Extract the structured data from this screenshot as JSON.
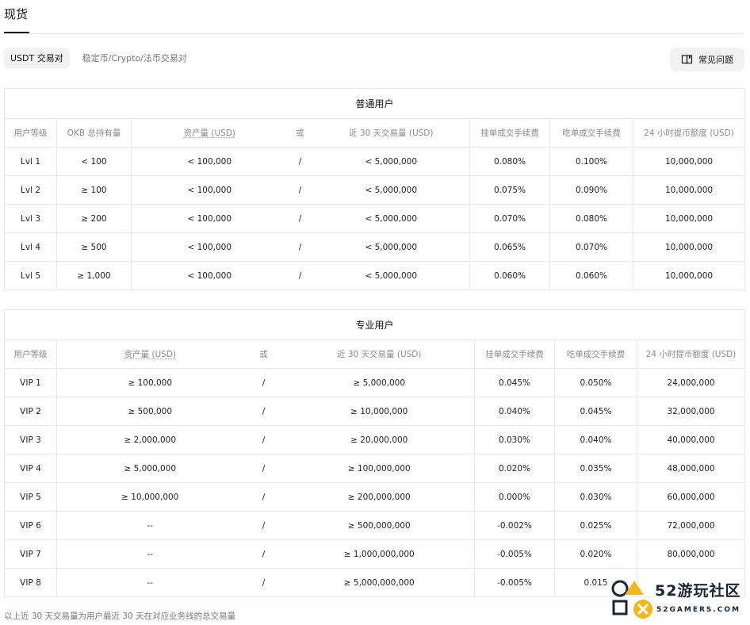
{
  "top_tab": "现货",
  "filters": {
    "active": "USDT 交易对",
    "other": "稳定币/Crypto/法币交易对"
  },
  "faq": "常见问题",
  "regular": {
    "title": "普通用户",
    "headers": [
      "用户等级",
      "OKB 总持有量",
      "资产量 (USD)",
      "或",
      "近 30 天交易量 (USD)",
      "挂单成交手续费",
      "吃单成交手续费",
      "24 小时提币额度 (USD)"
    ],
    "rows": [
      [
        "Lvl 1",
        "< 100",
        "< 100,000",
        "/",
        "< 5,000,000",
        "0.080%",
        "0.100%",
        "10,000,000"
      ],
      [
        "Lvl 2",
        "≥ 100",
        "< 100,000",
        "/",
        "< 5,000,000",
        "0.075%",
        "0.090%",
        "10,000,000"
      ],
      [
        "Lvl 3",
        "≥ 200",
        "< 100,000",
        "/",
        "< 5,000,000",
        "0.070%",
        "0.080%",
        "10,000,000"
      ],
      [
        "Lvl 4",
        "≥ 500",
        "< 100,000",
        "/",
        "< 5,000,000",
        "0.065%",
        "0.070%",
        "10,000,000"
      ],
      [
        "Lvl 5",
        "≥ 1,000",
        "< 100,000",
        "/",
        "< 5,000,000",
        "0.060%",
        "0.060%",
        "10,000,000"
      ]
    ]
  },
  "pro": {
    "title": "专业用户",
    "headers": [
      "用户等级",
      "资产量 (USD)",
      "或",
      "近 30 天交易量 (USD)",
      "挂单成交手续费",
      "吃单成交手续费",
      "24 小时提币额度 (USD)"
    ],
    "rows": [
      [
        "VIP 1",
        "≥ 100,000",
        "/",
        "≥ 5,000,000",
        "0.045%",
        "0.050%",
        "24,000,000"
      ],
      [
        "VIP 2",
        "≥ 500,000",
        "/",
        "≥ 10,000,000",
        "0.040%",
        "0.045%",
        "32,000,000"
      ],
      [
        "VIP 3",
        "≥ 2,000,000",
        "/",
        "≥ 20,000,000",
        "0.030%",
        "0.040%",
        "40,000,000"
      ],
      [
        "VIP 4",
        "≥ 5,000,000",
        "/",
        "≥ 100,000,000",
        "0.020%",
        "0.035%",
        "48,000,000"
      ],
      [
        "VIP 5",
        "≥ 10,000,000",
        "/",
        "≥ 200,000,000",
        "0.000%",
        "0.030%",
        "60,000,000"
      ],
      [
        "VIP 6",
        "--",
        "/",
        "≥ 500,000,000",
        "-0.002%",
        "0.025%",
        "72,000,000"
      ],
      [
        "VIP 7",
        "--",
        "/",
        "≥ 1,000,000,000",
        "-0.005%",
        "0.020%",
        "80,000,000"
      ],
      [
        "VIP 8",
        "--",
        "/",
        "≥ 5,000,000,000",
        "-0.005%",
        "0.015",
        ""
      ]
    ]
  },
  "footnote": "以上近 30 天交易量为用户最近 30 天在对应业务线的总交易量",
  "watermark": {
    "cn": "52游玩社区",
    "en": "52GAMERS.COM"
  },
  "colors": {
    "watermark_yellow": "#f5b81c",
    "watermark_navy": "#1d2433",
    "chip_bg": "#f2f2f2"
  }
}
